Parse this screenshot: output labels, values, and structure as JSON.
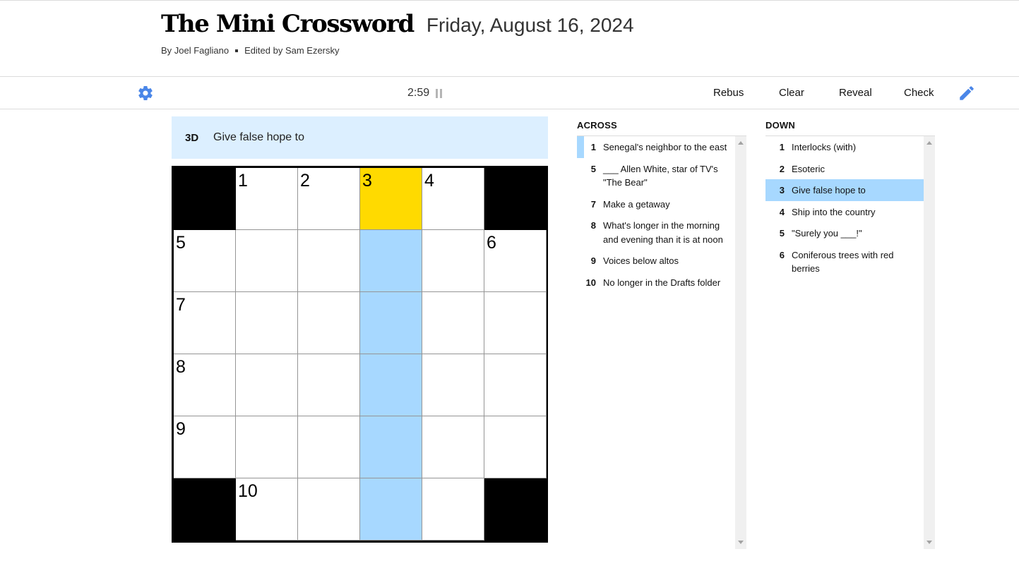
{
  "header": {
    "title": "The Mini Crossword",
    "date": "Friday, August 16, 2024",
    "author": "By Joel Fagliano",
    "editor": "Edited by Sam Ezersky"
  },
  "toolbar": {
    "timer": "2:59",
    "rebus": "Rebus",
    "clear": "Clear",
    "reveal": "Reveal",
    "check": "Check",
    "settings_icon": "gear-icon",
    "pencil_icon": "pencil-icon",
    "pause_icon": "pause-icon"
  },
  "active_clue": {
    "label": "3D",
    "text": "Give false hope to"
  },
  "colors": {
    "highlight": "#a7d8ff",
    "selected": "#ffda00",
    "clue_bar": "#dcefff",
    "icon_blue": "#4a86e8"
  },
  "grid": {
    "rows": 6,
    "cols": 6,
    "cells": [
      [
        {
          "black": true
        },
        {
          "num": "1"
        },
        {
          "num": "2"
        },
        {
          "num": "3",
          "state": "selected"
        },
        {
          "num": "4"
        },
        {
          "black": true
        }
      ],
      [
        {
          "num": "5"
        },
        {},
        {},
        {
          "state": "highlight"
        },
        {},
        {
          "num": "6"
        }
      ],
      [
        {
          "num": "7"
        },
        {},
        {},
        {
          "state": "highlight"
        },
        {},
        {}
      ],
      [
        {
          "num": "8"
        },
        {},
        {},
        {
          "state": "highlight"
        },
        {},
        {}
      ],
      [
        {
          "num": "9"
        },
        {},
        {},
        {
          "state": "highlight"
        },
        {},
        {}
      ],
      [
        {
          "black": true
        },
        {
          "num": "10"
        },
        {},
        {
          "state": "highlight"
        },
        {},
        {
          "black": true
        }
      ]
    ]
  },
  "across": {
    "heading": "ACROSS",
    "clues": [
      {
        "num": "1",
        "text": "Senegal's neighbor to the east",
        "marked": true
      },
      {
        "num": "5",
        "text": "___ Allen White, star of TV's \"The Bear\""
      },
      {
        "num": "7",
        "text": "Make a getaway"
      },
      {
        "num": "8",
        "text": "What's longer in the morning and evening than it is at noon"
      },
      {
        "num": "9",
        "text": "Voices below altos"
      },
      {
        "num": "10",
        "text": "No longer in the Drafts folder"
      }
    ]
  },
  "down": {
    "heading": "DOWN",
    "clues": [
      {
        "num": "1",
        "text": "Interlocks (with)"
      },
      {
        "num": "2",
        "text": "Esoteric"
      },
      {
        "num": "3",
        "text": "Give false hope to",
        "active": true
      },
      {
        "num": "4",
        "text": "Ship into the country"
      },
      {
        "num": "5",
        "text": "\"Surely you ___!\""
      },
      {
        "num": "6",
        "text": "Coniferous trees with red berries"
      }
    ]
  }
}
